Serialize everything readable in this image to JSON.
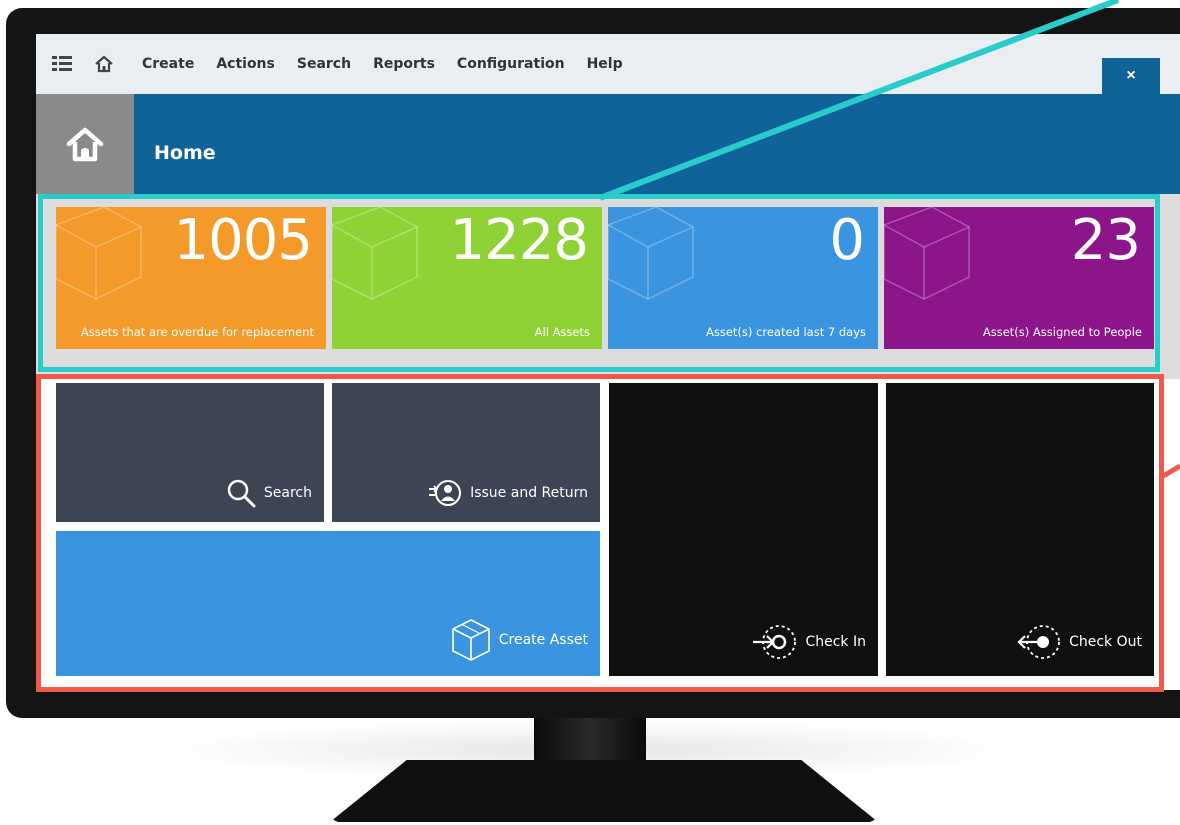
{
  "nav": {
    "menu_icon": "hamburger-menu-icon",
    "home_icon": "home-icon",
    "items": [
      "Create",
      "Actions",
      "Search",
      "Reports",
      "Configuration",
      "Help"
    ],
    "close_label": "×"
  },
  "header": {
    "title": "Home",
    "icon": "home-icon"
  },
  "kpis": [
    {
      "value": "1005",
      "label": "Assets that are overdue for replacement",
      "color": "#f39a2a"
    },
    {
      "value": "1228",
      "label": "All Assets",
      "color": "#8fd236"
    },
    {
      "value": "0",
      "label": "Asset(s) created last 7 days",
      "color": "#3a94df"
    },
    {
      "value": "23",
      "label": "Asset(s) Assigned to People",
      "color": "#8b1589"
    }
  ],
  "tiles": {
    "search": {
      "label": "Search",
      "icon": "search-icon",
      "color": "#3c4554"
    },
    "issue_return": {
      "label": "Issue and Return",
      "icon": "issue-return-icon",
      "color": "#3c4554"
    },
    "create_asset": {
      "label": "Create Asset",
      "icon": "cube-icon",
      "color": "#3a94df"
    },
    "check_in": {
      "label": "Check In",
      "icon": "check-in-icon",
      "color": "#101010"
    },
    "check_out": {
      "label": "Check Out",
      "icon": "check-out-icon",
      "color": "#101010"
    }
  },
  "callouts": {
    "kpi_color": "#28cccc",
    "actions_color": "#f0584a"
  }
}
